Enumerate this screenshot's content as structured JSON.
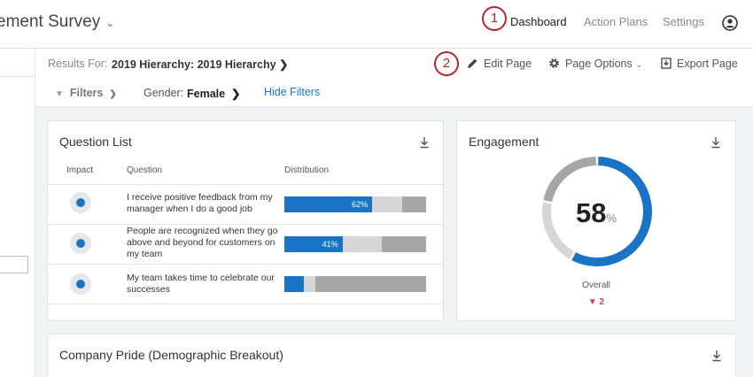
{
  "header": {
    "survey_title": "ement Survey",
    "nav": [
      {
        "label": "Dashboard",
        "active": true
      },
      {
        "label": "Action Plans",
        "active": false
      },
      {
        "label": "Settings",
        "active": false
      }
    ],
    "badges": [
      "1",
      "2"
    ]
  },
  "toolbar": {
    "results_label": "Results For:",
    "results_value": "2019 Hierarchy: 2019 Hierarchy",
    "edit_page": "Edit Page",
    "page_options": "Page Options",
    "export_page": "Export Page",
    "filters_label": "Filters",
    "gender_label": "Gender:",
    "gender_value": "Female",
    "hide_filters": "Hide Filters"
  },
  "question_list": {
    "title": "Question List",
    "columns": [
      "Impact",
      "Question",
      "Distribution"
    ],
    "rows": [
      {
        "question": "I receive positive feedback from my manager when I do a good job",
        "favorable": 62,
        "favorable_label": "62%",
        "neutral": 21,
        "unfavorable": 17
      },
      {
        "question": "People are recognized when they go above and beyond for customers on my team",
        "favorable": 41,
        "favorable_label": "41%",
        "neutral": 28,
        "unfavorable": 31
      },
      {
        "question": "My team takes time to celebrate our successes",
        "favorable": 14,
        "favorable_label": "",
        "neutral": 8,
        "unfavorable": 78
      }
    ]
  },
  "engagement": {
    "title": "Engagement",
    "score": "58",
    "score_value": 58,
    "unit": "%",
    "overall_label": "Overall",
    "delta": "▼ 2",
    "colors": {
      "favorable": "#1a73c4",
      "neutral": "#d6d6d6",
      "unfavorable": "#a6a6a6"
    },
    "segments": {
      "favorable": 58,
      "neutral": 20,
      "unfavorable": 22
    }
  },
  "company_pride": {
    "title": "Company Pride (Demographic Breakout)"
  }
}
